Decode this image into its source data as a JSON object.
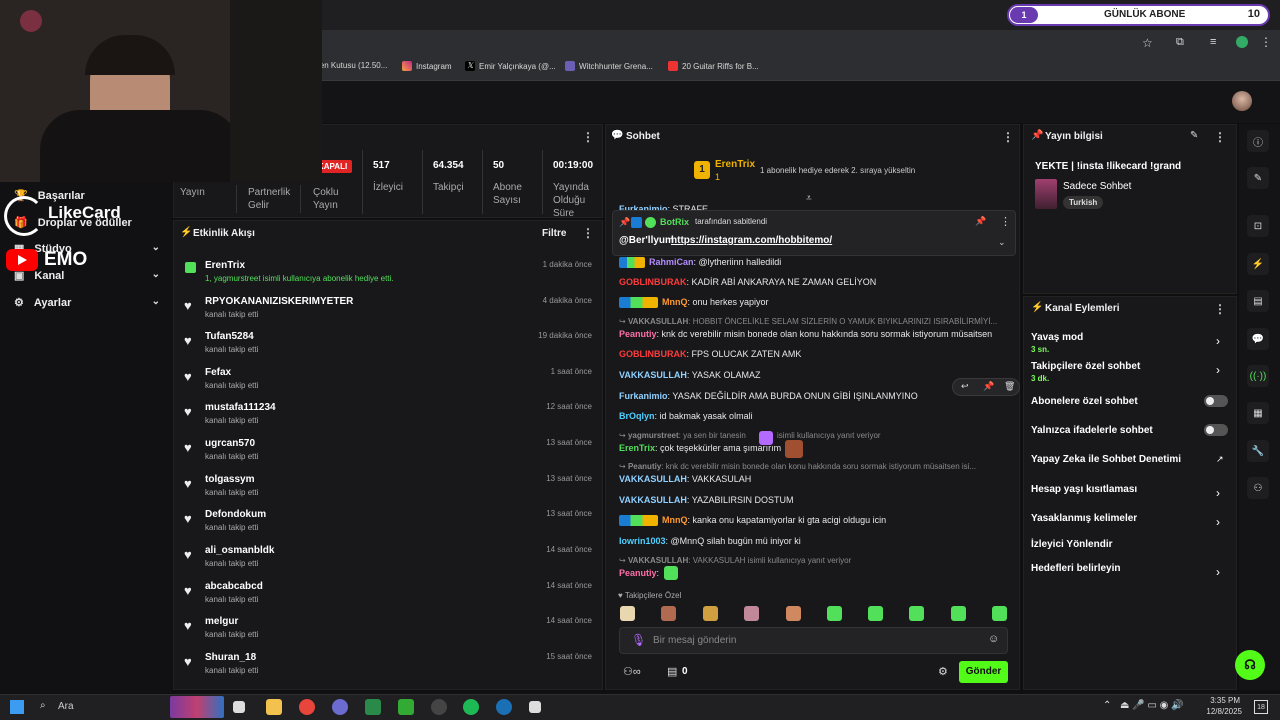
{
  "overlay": {
    "goal_num": "1",
    "goal_label": "GÜNLÜK ABONE",
    "goal_target": "10",
    "likecard": "LikeCard",
    "emo": "EMO"
  },
  "bookmarks": [
    "len Kutusu (12.50...",
    "Instagram",
    "Emir Yalçınkaya (@...",
    "Witchhunter Grena...",
    "20 Guitar Riffs for B..."
  ],
  "sidebar": {
    "items": [
      {
        "label": "Başarılar"
      },
      {
        "label": "Droplar ve ödüller"
      },
      {
        "label": "Stüdyo"
      },
      {
        "label": "Kanal"
      },
      {
        "label": "Ayarlar"
      }
    ]
  },
  "stats": {
    "status": "KAPALI",
    "items": [
      {
        "label": "Yayın",
        "value": ""
      },
      {
        "label": "Partnerlik Gelir",
        "value": ""
      },
      {
        "label": "Çoklu Yayın",
        "value": ""
      },
      {
        "label": "İzleyici",
        "value": "517"
      },
      {
        "label": "Takipçi",
        "value": "64.354"
      },
      {
        "label": "Abone Sayısı",
        "value": "50"
      },
      {
        "label": "Yayında Olduğu Süre",
        "value": "00:19:00"
      }
    ]
  },
  "activity": {
    "title": "Etkinlik Akışı",
    "filter": "Filtre",
    "events": [
      {
        "name": "ErenTrix",
        "sub": "1, yagmurstreet isimli kullanıcıya abonelik hediye etti.",
        "time": "1 dakika önce"
      },
      {
        "name": "RPYOKANANIZISKERIMYETER",
        "sub": "kanalı takip etti",
        "time": "4 dakika önce"
      },
      {
        "name": "Tufan5284",
        "sub": "kanalı takip etti",
        "time": "19 dakika önce"
      },
      {
        "name": "Fefax",
        "sub": "kanalı takip etti",
        "time": "1 saat önce"
      },
      {
        "name": "mustafa111234",
        "sub": "kanalı takip etti",
        "time": "12 saat önce"
      },
      {
        "name": "ugrcan570",
        "sub": "kanalı takip etti",
        "time": "13 saat önce"
      },
      {
        "name": "tolgassym",
        "sub": "kanalı takip etti",
        "time": "13 saat önce"
      },
      {
        "name": "Defondokum",
        "sub": "kanalı takip etti",
        "time": "13 saat önce"
      },
      {
        "name": "ali_osmanbldk",
        "sub": "kanalı takip etti",
        "time": "14 saat önce"
      },
      {
        "name": "abcabcabcd",
        "sub": "kanalı takip etti",
        "time": "14 saat önce"
      },
      {
        "name": "melgur",
        "sub": "kanalı takip etti",
        "time": "14 saat önce"
      },
      {
        "name": "Shuran_18",
        "sub": "kanalı takip etti",
        "time": "15 saat önce"
      }
    ]
  },
  "chat": {
    "title": "Sohbet",
    "gifter_name": "ErenTrix",
    "gifter_count": "1",
    "gift_text": "1 abonelik hediye ederek 2. sıraya yükseltin",
    "pinned_by": "BotRix",
    "pinned_by_suffix": "tarafından sabitlendi",
    "pinned_user": "@Ber'llyum",
    "pinned_link": "https://instagram.com/hobbitemo/",
    "messages": [
      {
        "user": "Furkanimio",
        "color": "#8fd1ff",
        "text": "STRAFE"
      },
      {
        "user": "RahmiCan",
        "color": "#b48cff",
        "text": "@lytheriinn halledildi"
      },
      {
        "user": "GOBLINBURAK",
        "color": "#ff3b3b",
        "text": "KADİR ABİ ANKARAYA NE ZAMAN GELİYON"
      },
      {
        "user": "MnnQ",
        "color": "#ff9a2e",
        "text": "onu herkes yapiyor"
      },
      {
        "user": "VAKKASULLAH",
        "color": "#8a8a8a",
        "text": "HOBBIT ÖNCELİKLE SELAM SİZLERİN O YAMUK BIYIKLARINIZI ISIRABİLİRMİYİ..."
      },
      {
        "user": "Peanutiy",
        "color": "#ff6fa8",
        "text": "knk dc verebilir misin bonede olan konu hakkında soru sormak istiyorum müsaitsen"
      },
      {
        "user": "GOBLINBURAK",
        "color": "#ff3b3b",
        "text": "FPS OLUCAK ZATEN AMK"
      },
      {
        "user": "VAKKASULLAH",
        "color": "#8fd1ff",
        "text": "YASAK OLAMAZ"
      },
      {
        "user": "Furkanimio",
        "color": "#8fd1ff",
        "text": "YASAK DEĞİLDİR AMA BURDA ONUN GİBİ IŞINLANMYINO"
      },
      {
        "user": "BrOqlyn",
        "color": "#4fd0ff",
        "text": "id bakmak yasak olmali"
      },
      {
        "user": "yagmurstreet",
        "color": "#8a8a8a",
        "text": "ya sen bir tanesin"
      },
      {
        "user": "isimli kullanıcıya yanıt veriyor",
        "color": "#8a8a8a",
        "text": ""
      },
      {
        "user": "ErenTrix",
        "color": "#52e05a",
        "text": "çok teşekkürler ama şımarırım"
      },
      {
        "user": "Peanutiy",
        "color": "#8a8a8a",
        "text": "knk dc verebilir misin bonede olan konu hakkında soru sormak istiyorum müsaitsen isi..."
      },
      {
        "user": "VAKKASULLAH",
        "color": "#8fd1ff",
        "text": "VAKKASULAH"
      },
      {
        "user": "VAKKASULLAH",
        "color": "#8fd1ff",
        "text": "YAZABILIRSIN DOSTUM"
      },
      {
        "user": "MnnQ",
        "color": "#ff9a2e",
        "text": "kanka onu kapatamiyorlar ki gta acigi oldugu icin"
      },
      {
        "user": "Iowrin1003",
        "color": "#4fd0ff",
        "text": "@MnnQ silah bugün mü iniyor ki"
      },
      {
        "user": "VAKKASULLAH",
        "color": "#8a8a8a",
        "text": "VAKKASULAH isimli kullanıcıya yanıt veriyor"
      },
      {
        "user": "Peanutiy",
        "color": "#ff6fa8",
        "text": ""
      }
    ],
    "followers_only": "Takipçilere Özel",
    "placeholder": "Bir mesaj gönderin",
    "points": "0",
    "send": "Gönder"
  },
  "stream_info": {
    "title": "Yayın bilgisi",
    "stream_title": "YEKTE | !insta !likecard !grand",
    "category": "Sadece Sohbet",
    "tag": "Turkish"
  },
  "channel_actions": {
    "title": "Kanal Eylemleri",
    "items": [
      {
        "label": "Yavaş mod",
        "sub": "3 sn."
      },
      {
        "label": "Takipçilere özel sohbet",
        "sub": "3 dk."
      },
      {
        "label": "Abonelere özel sohbet",
        "sub": ""
      },
      {
        "label": "Yalnızca ifadelerle sohbet",
        "sub": ""
      },
      {
        "label": "Yapay Zeka ile Sohbet Denetimi",
        "sub": ""
      },
      {
        "label": "Hesap yaşı kısıtlaması",
        "sub": ""
      },
      {
        "label": "Yasaklanmış kelimeler",
        "sub": ""
      },
      {
        "label": "İzleyici Yönlendir",
        "sub": ""
      },
      {
        "label": "Hedefleri belirleyin",
        "sub": ""
      }
    ]
  },
  "taskbar": {
    "search": "Ara",
    "time": "3:35 PM",
    "date": "12/8/2025",
    "badge": "18"
  },
  "colors": {
    "accent": "#53fc18",
    "bg": "#0f0f10",
    "panel": "#18181b"
  }
}
